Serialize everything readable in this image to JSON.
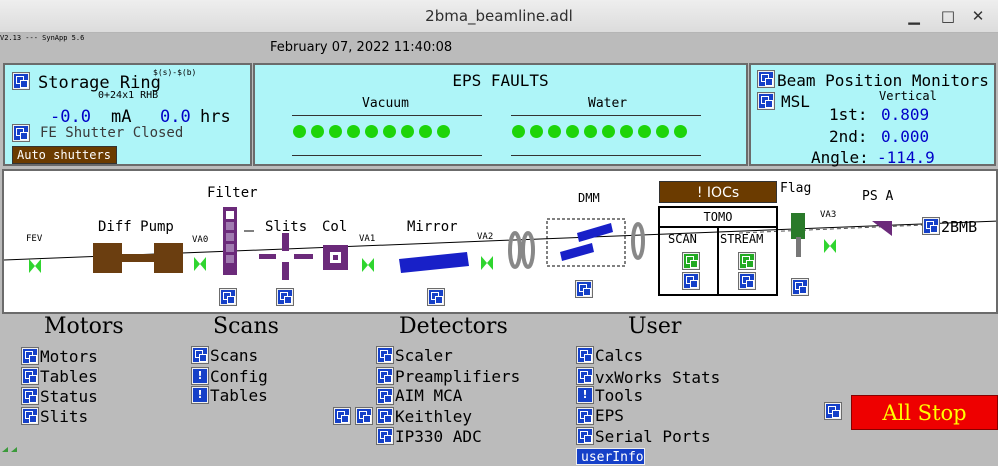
{
  "window": {
    "title": "2bma_beamline.adl",
    "minimize": "▁",
    "maximize": "□",
    "close": "✕"
  },
  "header": {
    "version": "V2.13 --- SynApp 5.6",
    "datetime": "February 07, 2022 11:40:08"
  },
  "storage_ring": {
    "title": "Storage Ring",
    "status_code": "$(s)-$(b)",
    "fill_pattern": "0+24x1 RHB",
    "current": "-0.0",
    "current_unit": "mA",
    "lifetime": "0.0",
    "lifetime_unit": "hrs",
    "fe_shutter": "FE Shutter Closed",
    "auto_shutters": "Auto shutters"
  },
  "eps": {
    "title": "EPS FAULTS",
    "vacuum_label": "Vacuum",
    "water_label": "Water",
    "vacuum_leds": 9,
    "water_leds": 10,
    "led_color": "#1ed40a"
  },
  "bpm": {
    "title": "Beam Position Monitors",
    "msl": "MSL",
    "vertical_label": "Vertical",
    "first_label": "1st:",
    "first_value": "0.809",
    "second_label": "2nd:",
    "second_value": "0.000",
    "angle_label": "Angle:",
    "angle_value": "-114.9",
    "value_color": "#0000c8"
  },
  "beamline": {
    "fev": "FEV",
    "diff_pump": "Diff Pump",
    "va0": "VA0",
    "filter": "Filter",
    "slits": "Slits",
    "col": "Col",
    "va1": "VA1",
    "mirror": "Mirror",
    "va2": "VA2",
    "dmm": "DMM",
    "iocs": "! IOCs",
    "tomo": "TOMO",
    "scan": "SCAN",
    "stream": "STREAM",
    "flag": "Flag",
    "va3": "VA3",
    "ps_a": "PS A",
    "station": "2BMB"
  },
  "menus": {
    "motors": {
      "title": "Motors",
      "items": [
        "Motors",
        "Tables",
        "Status",
        "Slits"
      ]
    },
    "scans": {
      "title": "Scans",
      "items": [
        "Scans",
        "Config",
        "Tables"
      ]
    },
    "detectors": {
      "title": "Detectors",
      "items": [
        "Scaler",
        "Preamplifiers",
        "AIM MCA",
        "Keithley",
        "IP330 ADC"
      ]
    },
    "user": {
      "title": "User",
      "items": [
        "Calcs",
        "vxWorks Stats",
        "Tools",
        "EPS",
        "Serial Ports"
      ],
      "user_info": "userInfo"
    }
  },
  "all_stop": {
    "label": "All Stop",
    "color": "#ee0000",
    "text_color": "#ffff00"
  }
}
